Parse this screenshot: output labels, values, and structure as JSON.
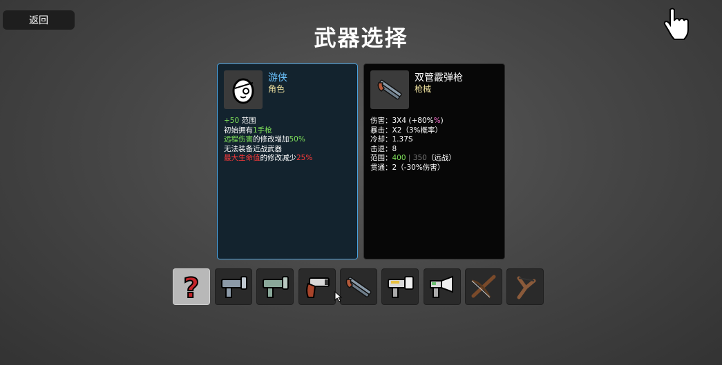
{
  "back_label": "返回",
  "title": "武器选择",
  "character": {
    "name": "游侠",
    "type": "角色",
    "name_color": "#6cc4ff",
    "lines": [
      [
        {
          "t": "+50",
          "c": "green"
        },
        {
          "t": " 范围",
          "c": ""
        }
      ],
      [
        {
          "t": "初始拥有",
          "c": ""
        },
        {
          "t": "1手枪",
          "c": "green"
        }
      ],
      [
        {
          "t": "远程伤害",
          "c": "green"
        },
        {
          "t": "的修改增加",
          "c": ""
        },
        {
          "t": "50%",
          "c": "green"
        }
      ],
      [
        {
          "t": "无法装备近战武器",
          "c": ""
        }
      ],
      [
        {
          "t": "最大生命值",
          "c": "red"
        },
        {
          "t": "的修改减少",
          "c": ""
        },
        {
          "t": "25%",
          "c": "red"
        }
      ]
    ]
  },
  "weapon": {
    "name": "双管霰弹枪",
    "type": "枪械",
    "lines": [
      [
        {
          "t": "伤害：3X4 (+80%",
          "c": ""
        },
        {
          "t": "%",
          "c": "pink"
        },
        {
          "t": ")",
          "c": ""
        }
      ],
      [
        {
          "t": "暴击：X2（3%概率）",
          "c": ""
        }
      ],
      [
        {
          "t": "冷却：1.37S",
          "c": ""
        }
      ],
      [
        {
          "t": "击退：8",
          "c": ""
        }
      ],
      [
        {
          "t": "范围：",
          "c": ""
        },
        {
          "t": "400",
          "c": "green"
        },
        {
          "t": " | 350",
          "c": "dim"
        },
        {
          "t": "（远战）",
          "c": ""
        }
      ],
      [
        {
          "t": "贯通：2（-30%伤害）",
          "c": ""
        }
      ]
    ]
  },
  "slots": [
    {
      "name": "random-weapon",
      "icon": "question-icon",
      "selected": true
    },
    {
      "name": "smg",
      "icon": "smg-icon",
      "selected": false
    },
    {
      "name": "green-pistol",
      "icon": "pistol-green-icon",
      "selected": false
    },
    {
      "name": "revolver",
      "icon": "revolver-icon",
      "selected": false
    },
    {
      "name": "double-barrel-shotgun",
      "icon": "shotgun-icon",
      "selected": false
    },
    {
      "name": "taser",
      "icon": "taser-icon",
      "selected": false
    },
    {
      "name": "megaphone-gun",
      "icon": "megaphone-icon",
      "selected": false
    },
    {
      "name": "crossbow",
      "icon": "crossbow-icon",
      "selected": false
    },
    {
      "name": "slingshot",
      "icon": "slingshot-icon",
      "selected": false
    }
  ]
}
